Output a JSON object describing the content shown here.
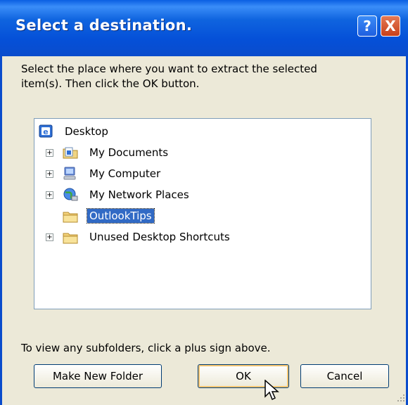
{
  "dialog": {
    "title": "Select a destination.",
    "help_glyph": "?",
    "close_glyph": "X",
    "instruction": "Select the place where you want to extract the selected\nitem(s).  Then click the OK button.",
    "hint": "To view any subfolders, click a plus sign above."
  },
  "tree": {
    "root": {
      "label": "Desktop",
      "icon": "desktop-icon"
    },
    "items": [
      {
        "label": "My Documents",
        "icon": "my-documents-icon",
        "expandable": true,
        "selected": false
      },
      {
        "label": "My Computer",
        "icon": "my-computer-icon",
        "expandable": true,
        "selected": false
      },
      {
        "label": "My Network Places",
        "icon": "network-places-icon",
        "expandable": true,
        "selected": false
      },
      {
        "label": "OutlookTips",
        "icon": "folder-icon",
        "expandable": false,
        "selected": true
      },
      {
        "label": "Unused Desktop Shortcuts",
        "icon": "folder-icon",
        "expandable": true,
        "selected": false
      }
    ],
    "expander_glyph": "+"
  },
  "buttons": {
    "make_new_folder": "Make New Folder",
    "ok": "OK",
    "cancel": "Cancel"
  },
  "colors": {
    "title_bar": "#0a4ccc",
    "selection": "#316ac5",
    "dialog_bg": "#ece9d8"
  }
}
